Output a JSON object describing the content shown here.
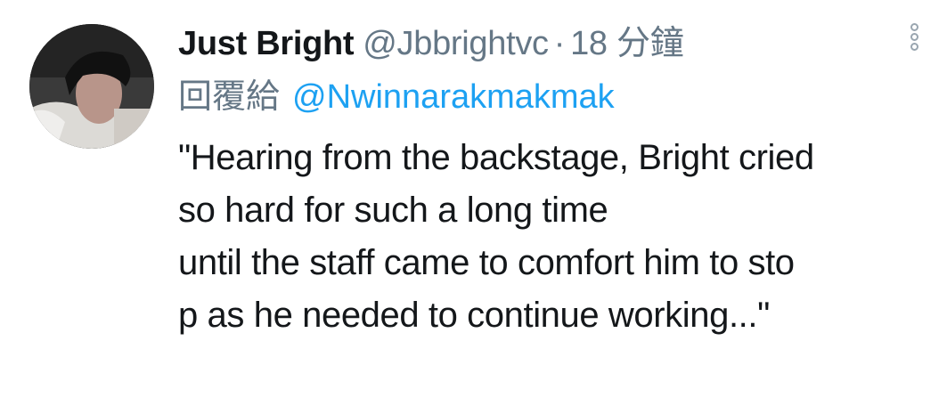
{
  "tweet": {
    "display_name": "Just Bright",
    "handle": "@Jbbrightvc",
    "separator": "·",
    "time": "18 分鐘",
    "reply_prefix": "回覆給",
    "reply_to": "@Nwinnarakmakmak",
    "lines": [
      "\"Hearing from the backstage, Bright cried",
      "so hard for such a long time",
      "until the staff came to comfort him to sto",
      "p as he needed to continue working...\""
    ]
  },
  "icons": {
    "avatar": "profile-photo",
    "more": "vertical-dots-icon"
  },
  "colors": {
    "name": "#14171a",
    "meta": "#657786",
    "link": "#1da1f2"
  }
}
